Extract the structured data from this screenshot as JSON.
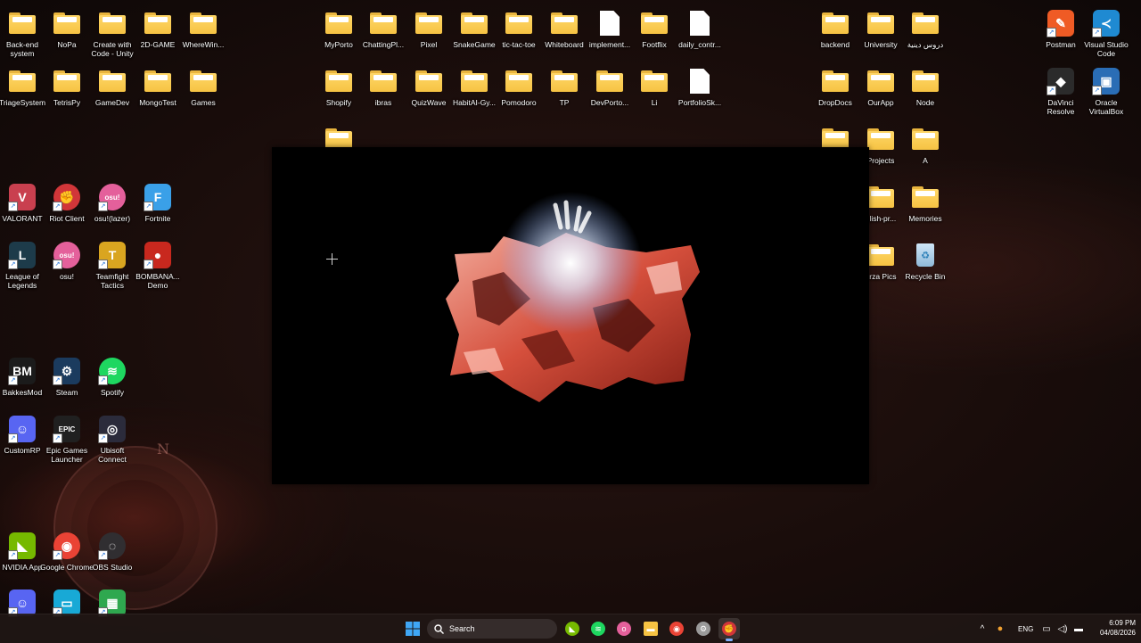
{
  "desktop": {
    "icons": [
      {
        "label": "Back-end system",
        "kind": "folder"
      },
      {
        "label": "NoPa",
        "kind": "folder"
      },
      {
        "label": "Create with Code - Unity",
        "kind": "folder"
      },
      {
        "label": "2D-GAME",
        "kind": "folder"
      },
      {
        "label": "WhereWin...",
        "kind": "folder"
      },
      {
        "label": "TriageSystem",
        "kind": "folder"
      },
      {
        "label": "TetrisPy",
        "kind": "folder"
      },
      {
        "label": "GameDev",
        "kind": "folder"
      },
      {
        "label": "MongoTest",
        "kind": "folder"
      },
      {
        "label": "Games",
        "kind": "folder"
      },
      {
        "label": "MyPorto",
        "kind": "folder"
      },
      {
        "label": "ChattingPl...",
        "kind": "folder"
      },
      {
        "label": "Pixel",
        "kind": "folder"
      },
      {
        "label": "SnakeGame",
        "kind": "folder"
      },
      {
        "label": "tic-tac-toe",
        "kind": "folder"
      },
      {
        "label": "Whiteboard",
        "kind": "folder"
      },
      {
        "label": "implement...",
        "kind": "doc"
      },
      {
        "label": "Footflix",
        "kind": "folder"
      },
      {
        "label": "daily_contr...",
        "kind": "doc"
      },
      {
        "label": "Shopify",
        "kind": "folder"
      },
      {
        "label": "ibras",
        "kind": "folder"
      },
      {
        "label": "QuizWave",
        "kind": "folder"
      },
      {
        "label": "HabitAI-Gy...",
        "kind": "folder"
      },
      {
        "label": "Pomodoro",
        "kind": "folder"
      },
      {
        "label": "TP",
        "kind": "folder"
      },
      {
        "label": "DevPorto...",
        "kind": "folder"
      },
      {
        "label": "Li",
        "kind": "folder"
      },
      {
        "label": "PortfolioSk...",
        "kind": "doc"
      },
      {
        "label": "",
        "kind": "folder"
      },
      {
        "label": "backend",
        "kind": "folder"
      },
      {
        "label": "University",
        "kind": "folder"
      },
      {
        "label": "دروس دينية",
        "kind": "folder"
      },
      {
        "label": "DropDocs",
        "kind": "folder"
      },
      {
        "label": "OurApp",
        "kind": "folder"
      },
      {
        "label": "Node",
        "kind": "folder"
      },
      {
        "label": "",
        "kind": "folder"
      },
      {
        "label": "Projects",
        "kind": "folder"
      },
      {
        "label": "A",
        "kind": "folder"
      },
      {
        "label": "glish-pr...",
        "kind": "folder"
      },
      {
        "label": "Memories",
        "kind": "folder"
      },
      {
        "label": "orza Pics",
        "kind": "folder"
      },
      {
        "label": "Recycle Bin",
        "kind": "bin"
      },
      {
        "label": "Postman",
        "kind": "app",
        "color": "#ef5b25",
        "glyph": "✎"
      },
      {
        "label": "Visual Studio Code",
        "kind": "app",
        "color": "#1f8ad2",
        "glyph": "≺"
      },
      {
        "label": "DaVinci Resolve",
        "kind": "app",
        "color": "#2b2b2b",
        "glyph": "◆"
      },
      {
        "label": "Oracle VirtualBox",
        "kind": "app",
        "color": "#2a6db5",
        "glyph": "▣"
      },
      {
        "label": "VALORANT",
        "kind": "app",
        "color": "#c9404f",
        "glyph": "V"
      },
      {
        "label": "Riot Client",
        "kind": "app",
        "color": "#d13639",
        "glyph": "✊"
      },
      {
        "label": "osu!(lazer)",
        "kind": "app",
        "color": "#e4609b",
        "glyph": "osu!"
      },
      {
        "label": "Fortnite",
        "kind": "app",
        "color": "#3aa0e8",
        "glyph": "F"
      },
      {
        "label": "League of Legends",
        "kind": "app",
        "color": "#1d3b4a",
        "glyph": "L"
      },
      {
        "label": "osu!",
        "kind": "app",
        "color": "#e4609b",
        "glyph": "osu!"
      },
      {
        "label": "Teamfight Tactics",
        "kind": "app",
        "color": "#d9a520",
        "glyph": "T"
      },
      {
        "label": "BOMBANA... Demo",
        "kind": "app",
        "color": "#c8281e",
        "glyph": "●"
      },
      {
        "label": "BakkesMod",
        "kind": "app",
        "color": "#1b1b1b",
        "glyph": "BM"
      },
      {
        "label": "Steam",
        "kind": "app",
        "color": "#1b3b5e",
        "glyph": "⚙"
      },
      {
        "label": "Spotify",
        "kind": "app",
        "color": "#1ed760",
        "glyph": "≋"
      },
      {
        "label": "CustomRP",
        "kind": "app",
        "color": "#5865f2",
        "glyph": "☺"
      },
      {
        "label": "Epic Games Launcher",
        "kind": "app",
        "color": "#202020",
        "glyph": "EPIC"
      },
      {
        "label": "Ubisoft Connect",
        "kind": "app",
        "color": "#2b2b3b",
        "glyph": "◎"
      },
      {
        "label": "NVIDIA App",
        "kind": "app",
        "color": "#76b900",
        "glyph": "◣"
      },
      {
        "label": "Google Chrome",
        "kind": "app",
        "color": "#ea4335",
        "glyph": "◉"
      },
      {
        "label": "OBS Studio",
        "kind": "app",
        "color": "#302e31",
        "glyph": "◌"
      },
      {
        "label": "",
        "kind": "app",
        "color": "#5865f2",
        "glyph": "☺"
      },
      {
        "label": "",
        "kind": "app",
        "color": "#18a9d6",
        "glyph": "▭"
      },
      {
        "label": "",
        "kind": "app",
        "color": "#2fa84f",
        "glyph": "▦"
      }
    ]
  },
  "taskbar": {
    "search_placeholder": "Search",
    "language": "ENG",
    "time": "6:09 PM",
    "date": "04/08/2026",
    "apps": [
      {
        "name": "nvidia",
        "color": "#76b900",
        "glyph": "◣"
      },
      {
        "name": "spotify",
        "color": "#1ed760",
        "glyph": "≋"
      },
      {
        "name": "osu",
        "color": "#e4609b",
        "glyph": "o"
      },
      {
        "name": "file-explorer",
        "color": "#f6c343",
        "glyph": "▬"
      },
      {
        "name": "chrome",
        "color": "#ea4335",
        "glyph": "◉"
      },
      {
        "name": "steam-notification",
        "color": "#9a9a9a",
        "glyph": "⚙"
      },
      {
        "name": "riot-client",
        "color": "#d13639",
        "glyph": "✊"
      }
    ]
  }
}
